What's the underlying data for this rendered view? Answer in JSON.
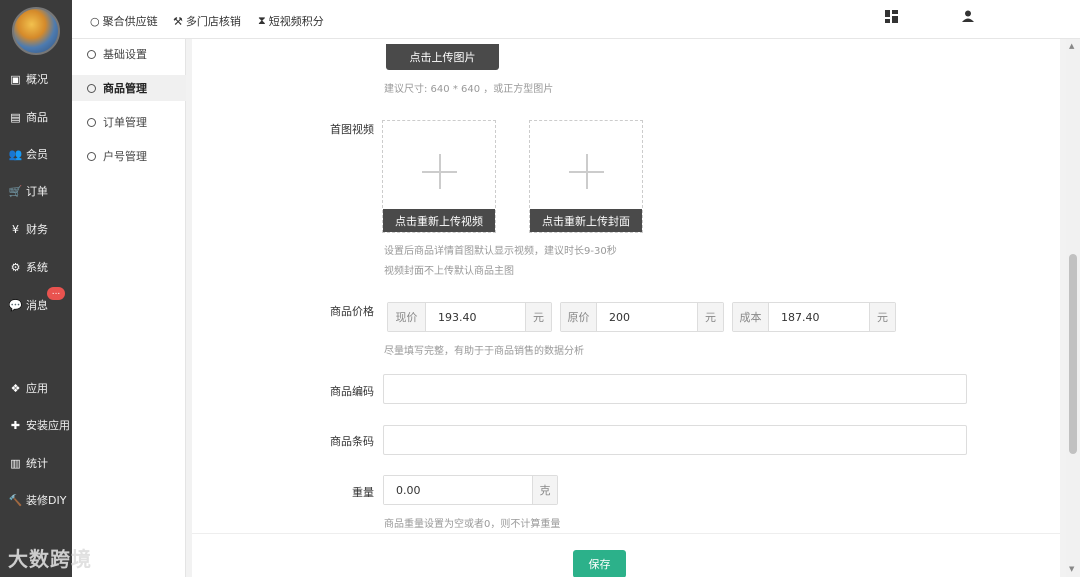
{
  "sidebar": {
    "items": [
      {
        "label": "概况",
        "icon": "dashboard-icon",
        "glyph": "▣"
      },
      {
        "label": "商品",
        "icon": "goods-icon",
        "glyph": "▤"
      },
      {
        "label": "会员",
        "icon": "users-icon",
        "glyph": "👥"
      },
      {
        "label": "订单",
        "icon": "cart-icon",
        "glyph": "🛒"
      },
      {
        "label": "财务",
        "icon": "yen-icon",
        "glyph": "¥"
      },
      {
        "label": "系统",
        "icon": "gears-icon",
        "glyph": "⚙"
      },
      {
        "label": "消息",
        "icon": "chat-icon",
        "glyph": "💬"
      },
      {
        "label": "应用",
        "icon": "apps-icon",
        "glyph": "❖"
      },
      {
        "label": "安装应用",
        "icon": "puzzle-icon",
        "glyph": "✚"
      },
      {
        "label": "统计",
        "icon": "bar-chart-icon",
        "glyph": "▥"
      },
      {
        "label": "装修DIY",
        "icon": "gavel-icon",
        "glyph": "🔨"
      }
    ],
    "message_badge": "..."
  },
  "topbar": {
    "links": [
      {
        "label": "聚合供应链",
        "icon": "circle-icon",
        "glyph": "○"
      },
      {
        "label": "多门店核销",
        "icon": "gavel-icon",
        "glyph": "⚒"
      },
      {
        "label": "短视频积分",
        "icon": "hourglass-icon",
        "glyph": "⧗"
      }
    ]
  },
  "submenu": {
    "items": [
      {
        "label": "基础设置",
        "active": false
      },
      {
        "label": "商品管理",
        "active": true
      },
      {
        "label": "订单管理",
        "active": false
      },
      {
        "label": "户号管理",
        "active": false
      }
    ]
  },
  "form": {
    "upload_image_btn": "点击上传图片",
    "image_size_hint": "建议尺寸: 640 * 640 ，或正方型图片",
    "video_label": "首图视频",
    "reupload_video": "点击重新上传视频",
    "reupload_cover": "点击重新上传封面",
    "video_hint_1": "设置后商品详情首图默认显示视频，建议时长9-30秒",
    "video_hint_2": "视频封面不上传默认商品主图",
    "price_label": "商品价格",
    "price": {
      "current_addon": "现价",
      "current_value": "193.40",
      "original_addon": "原价",
      "original_value": "200",
      "cost_addon": "成本",
      "cost_value": "187.40",
      "unit": "元"
    },
    "price_hint": "尽量填写完整，有助于于商品销售的数据分析",
    "code_label": "商品编码",
    "code_value": "",
    "barcode_label": "商品条码",
    "barcode_value": "",
    "weight_label": "重量",
    "weight_value": "0.00",
    "weight_unit": "克",
    "weight_hint": "商品重量设置为空或者0，则不计算重量",
    "save_label": "保存"
  },
  "watermark": "大数跨境"
}
